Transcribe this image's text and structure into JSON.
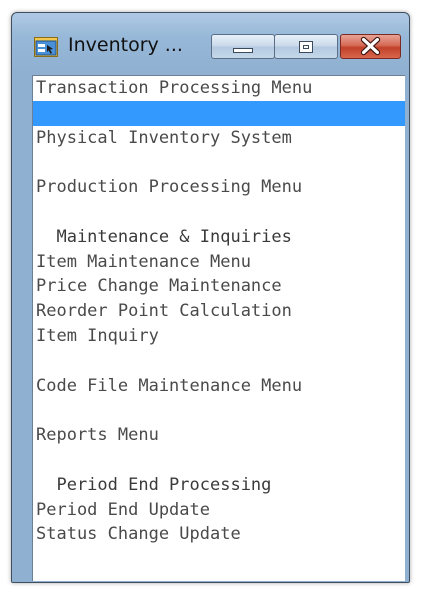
{
  "window": {
    "title": "Inventory ...",
    "icon": "inventory-app-icon",
    "buttons": {
      "minimize": "minimize-icon",
      "maximize": "maximize-icon",
      "close": "close-icon"
    }
  },
  "menu": {
    "selected_index": 1,
    "items": [
      {
        "text": "Transaction Processing Menu",
        "type": "option"
      },
      {
        "text": "",
        "type": "option"
      },
      {
        "text": "Physical Inventory System",
        "type": "option"
      },
      {
        "text": "",
        "type": "blank"
      },
      {
        "text": "Production Processing Menu",
        "type": "option"
      },
      {
        "text": "",
        "type": "blank"
      },
      {
        "text": "  Maintenance & Inquiries",
        "type": "heading"
      },
      {
        "text": "Item Maintenance Menu",
        "type": "option"
      },
      {
        "text": "Price Change Maintenance",
        "type": "option"
      },
      {
        "text": "Reorder Point Calculation",
        "type": "option"
      },
      {
        "text": "Item Inquiry",
        "type": "option"
      },
      {
        "text": "",
        "type": "blank"
      },
      {
        "text": "Code File Maintenance Menu",
        "type": "option"
      },
      {
        "text": "",
        "type": "blank"
      },
      {
        "text": "Reports Menu",
        "type": "option"
      },
      {
        "text": "",
        "type": "blank"
      },
      {
        "text": "  Period End Processing",
        "type": "heading"
      },
      {
        "text": "Period End Update",
        "type": "option"
      },
      {
        "text": "Status Change Update",
        "type": "option"
      }
    ]
  },
  "colors": {
    "selection": "#3399ff",
    "text": "#4a4a4a",
    "frame": "#97b8d8",
    "close_button": "#c0412a"
  }
}
